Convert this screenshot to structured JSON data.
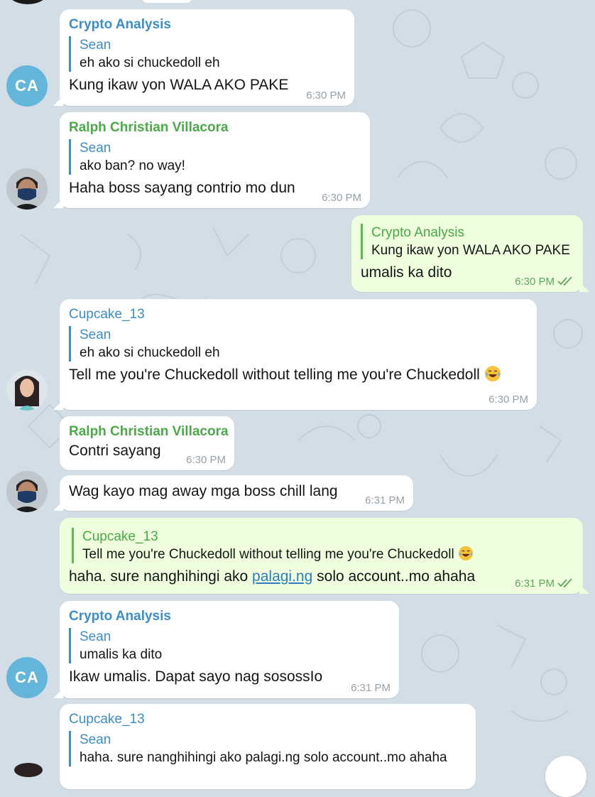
{
  "colors": {
    "background": "#d3dde6",
    "incoming_bubble": "#ffffff",
    "outgoing_bubble": "#effedd",
    "sender_blue": "#3c8ec9",
    "sender_green": "#4aaa47",
    "avatar_ca": "#63b6d9",
    "link": "#2d7ec1"
  },
  "messages": [
    {
      "sender": "Crypto Analysis",
      "reply_name": "Sean",
      "reply_text": "eh ako si chuckedoll eh",
      "text": "Kung ikaw yon WALA AKO PAKE",
      "time": "6:30 PM",
      "avatar": "CA"
    },
    {
      "sender": "Ralph Christian Villacora",
      "reply_name": "Sean",
      "reply_text": "ako ban? no way!",
      "text": "Haha boss sayang contrio mo dun",
      "time": "6:30 PM",
      "avatar_icon": "user-photo-masked-man"
    },
    {
      "reply_name": "Crypto Analysis",
      "reply_text": "Kung ikaw yon WALA AKO PAKE",
      "text": "umalis ka dito",
      "time": "6:30 PM",
      "status_icon": "double-check-icon"
    },
    {
      "sender": "Cupcake_13",
      "reply_name": "Sean",
      "reply_text": "eh ako si chuckedoll eh",
      "text": "Tell me you're Chuckedoll without telling me you're Chuckedoll",
      "emoji": "laughing-tears-emoji",
      "time": "6:30 PM",
      "avatar_icon": "user-photo-woman"
    },
    {
      "sender": "Ralph Christian Villacora",
      "text": "Contri sayang",
      "time": "6:30 PM"
    },
    {
      "text": "Wag kayo mag away mga boss chill lang",
      "time": "6:31 PM",
      "avatar_icon": "user-photo-masked-man"
    },
    {
      "reply_name": "Cupcake_13",
      "reply_text": "Tell me you're Chuckedoll without telling me you're Chuckedoll",
      "text_before_link": "haha. sure nanghihingi ako",
      "link_text": "palagi.ng",
      "text_after_link": "solo account..mo ahaha",
      "time": "6:31 PM",
      "status_icon": "double-check-icon"
    },
    {
      "sender": "Crypto Analysis",
      "reply_name": "Sean",
      "reply_text": "umalis ka dito",
      "text": "Ikaw umalis. Dapat sayo nag sosossIo",
      "time": "6:31 PM",
      "avatar": "CA"
    },
    {
      "sender": "Cupcake_13",
      "reply_name": "Sean",
      "reply_text": "haha. sure nanghihingi ako palagi.ng solo account..mo ahaha"
    }
  ]
}
